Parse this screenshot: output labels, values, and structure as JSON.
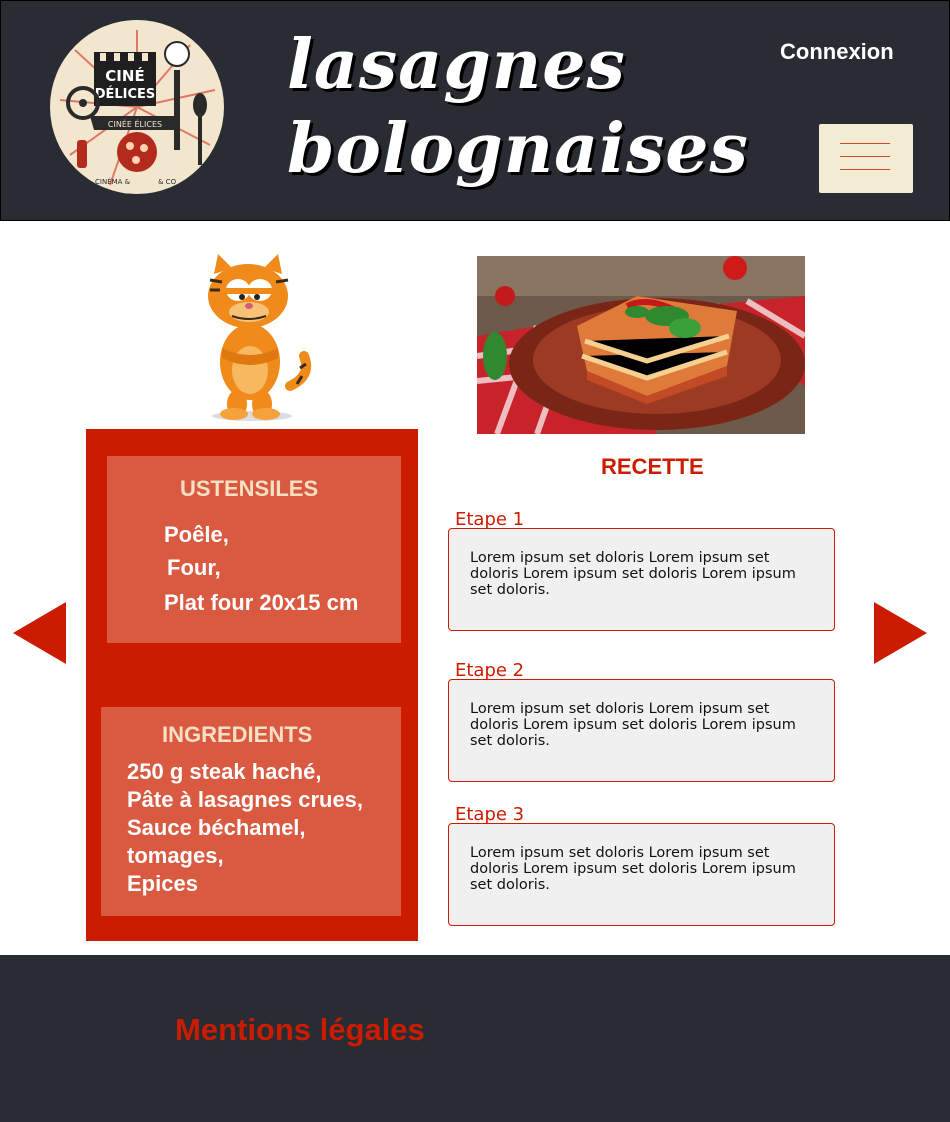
{
  "header": {
    "title": "lasagnes bolognaises",
    "login_label": "Connexion",
    "logo_text_1": "CINÉ",
    "logo_text_2": "DÉLICES",
    "logo_banner": "CINÉE ÉLICES",
    "logo_bottom_left": "CINÉMA &",
    "logo_bottom_right": "& CO"
  },
  "colors": {
    "header_bg": "#292c33",
    "accent_red": "#cc1c00",
    "box_bg": "#d95a41",
    "burger_bg": "#f1ecd2"
  },
  "ustensiles": {
    "title": "USTENSILES",
    "items": [
      "Poêle,",
      "Four,",
      "Plat four 20x15 cm"
    ]
  },
  "ingredients": {
    "title": "INGREDIENTS",
    "items": [
      "250 g steak haché,",
      "Pâte à lasagnes crues,",
      "Sauce béchamel,",
      "tomages,",
      "Epices"
    ]
  },
  "recette": {
    "title": "RECETTE",
    "steps": [
      {
        "label": "Etape 1",
        "text": "Lorem ipsum set doloris Lorem ipsum set doloris Lorem ipsum set doloris Lorem ipsum set doloris."
      },
      {
        "label": "Etape 2",
        "text": "Lorem ipsum set doloris Lorem ipsum set doloris Lorem ipsum set doloris Lorem ipsum set doloris."
      },
      {
        "label": "Etape 3",
        "text": "Lorem ipsum set doloris Lorem ipsum set doloris Lorem ipsum set doloris Lorem ipsum set doloris."
      }
    ]
  },
  "footer": {
    "legal_label": "Mentions légales"
  },
  "icons": {
    "prev": "triangle-left-icon",
    "next": "triangle-right-icon",
    "menu": "hamburger-menu-icon"
  }
}
